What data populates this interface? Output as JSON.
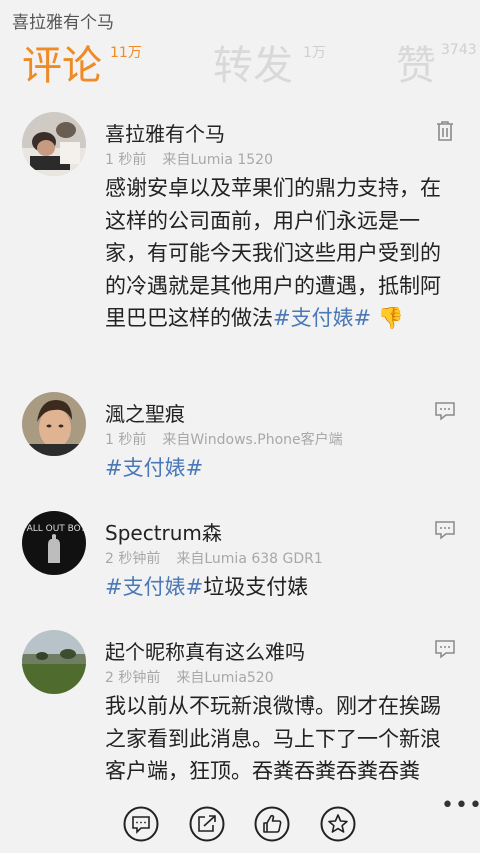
{
  "header": {
    "title": "喜拉雅有个马"
  },
  "pivot": {
    "tabs": [
      {
        "label": "评论",
        "count": "11万"
      },
      {
        "label": "转发",
        "count": "1万"
      },
      {
        "label": "赞",
        "count": "3743"
      }
    ]
  },
  "comments": [
    {
      "username": "喜拉雅有个马",
      "time": "1 秒前",
      "source": "来自Lumia 1520",
      "text": "感谢安卓以及苹果们的鼎力支持，在这样的公司面前，用户们永远是一家，有可能今天我们这些用户受到的的冷遇就是其他用户的遭遇，抵制阿里巴巴这样的做法",
      "tag": "#支付婊#",
      "emoji": "👎"
    },
    {
      "username": "渢之聖痕",
      "time": "1 秒前",
      "source": "来自Windows.Phone客户端",
      "tag": "#支付婊#"
    },
    {
      "username": "Spectrum森",
      "time": "2 秒钟前",
      "source": "来自Lumia 638 GDR1",
      "tag": "#支付婊#",
      "text": "垃圾支付婊"
    },
    {
      "username": "起个昵称真有这么难吗",
      "time": "2 秒钟前",
      "source": "来自Lumia520",
      "text": "我以前从不玩新浪微博。刚才在挨踢之家看到此消息。马上下了一个新浪客户端，狂顶。吞粪吞粪吞粪吞粪"
    }
  ],
  "appbar": {
    "more": "•••"
  },
  "colors": {
    "accent": "#f08a24",
    "topic": "#4a78b8",
    "meta": "#a8a8a8"
  },
  "icons": [
    "delete-icon",
    "reply-icon",
    "comment-icon",
    "repost-icon",
    "like-icon",
    "favorite-icon",
    "more-icon"
  ]
}
